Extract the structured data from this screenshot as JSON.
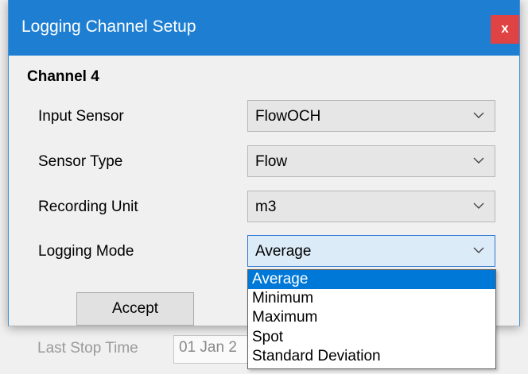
{
  "background": {
    "last_stop_label": "Last Stop Time",
    "last_stop_value": "01 Jan 2"
  },
  "dialog": {
    "title": "Logging Channel Setup",
    "close_label": "x",
    "heading": "Channel 4",
    "fields": [
      {
        "label": "Input Sensor",
        "value": "FlowOCH"
      },
      {
        "label": "Sensor Type",
        "value": "Flow"
      },
      {
        "label": "Recording Unit",
        "value": "m3"
      },
      {
        "label": "Logging Mode",
        "value": "Average"
      }
    ],
    "accept_label": "Accept",
    "logging_mode_options": [
      "Average",
      "Minimum",
      "Maximum",
      "Spot",
      "Standard Deviation"
    ],
    "selected_option": "Average"
  },
  "colors": {
    "titlebar": "#1e7fd2",
    "close_button": "#e04343",
    "selection": "#0078d7"
  }
}
